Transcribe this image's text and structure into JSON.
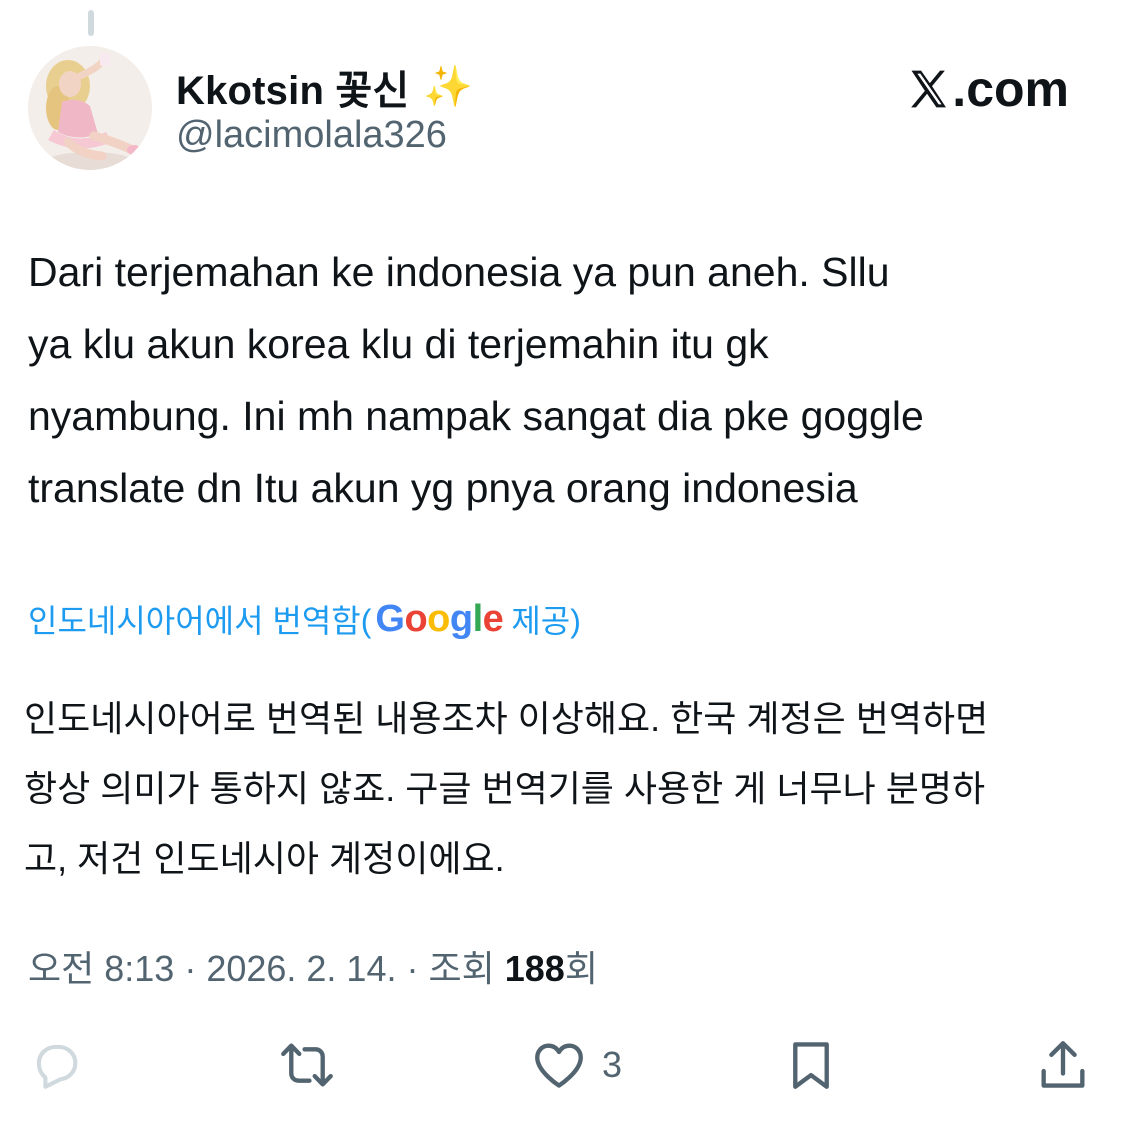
{
  "author": {
    "display_name": "Kkotsin 꽃신",
    "emoji": "✨",
    "handle": "@lacimolala326",
    "avatar_icon": "profile-photo"
  },
  "site": {
    "label": ".com",
    "logo_icon": "x-logo-icon"
  },
  "tweet": {
    "text": "Dari terjemahan ke indonesia ya pun aneh. Sllu\nya klu akun korea klu di terjemahin itu gk\nnyambung. Ini mh nampak sangat dia pke goggle\ntranslate dn Itu akun yg pnya orang indonesia"
  },
  "translation": {
    "label_prefix": "인도네시아어에서 번역함(",
    "google_letters": [
      "G",
      "o",
      "o",
      "g",
      "l",
      "e"
    ],
    "label_suffix": " 제공)",
    "text": "인도네시아어로 번역된 내용조차 이상해요. 한국 계정은 번역하면\n항상 의미가 통하지 않죠. 구글 번역기를 사용한 게 너무나 분명하\n고, 저건 인도네시아 계정이에요."
  },
  "meta": {
    "time": "오전 8:13",
    "separator": " · ",
    "date": "2026. 2. 14.",
    "views_prefix": "조회 ",
    "views_count": "188",
    "views_suffix": "회"
  },
  "actions": {
    "like_count": "3",
    "icons": [
      "reply-icon",
      "retweet-icon",
      "heart-icon",
      "bookmark-icon",
      "share-icon"
    ]
  },
  "colors": {
    "accent": "#1d9bf0",
    "text": "#0f1419",
    "secondary": "#536471",
    "google_blue": "#4285f4",
    "google_red": "#ea4335",
    "google_yellow": "#fbbc05",
    "google_green": "#34a853"
  }
}
